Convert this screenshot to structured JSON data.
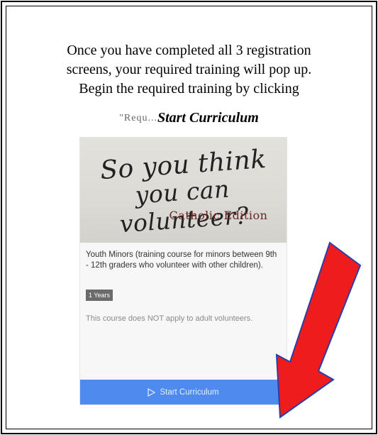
{
  "instructions": {
    "line1": "Once you have completed all 3 registration",
    "line2": "screens, your required training will pop up.",
    "line3": "Begin the required training by clicking",
    "faded_prefix": "\"Requ...",
    "cta_text": "Start Curriculum"
  },
  "course_card": {
    "banner": {
      "line1": "So you think",
      "line2": "you can volunteer?",
      "line3": "Catholic Edition"
    },
    "description": "Youth Minors (training course for minors between 9th - 12th graders who volunteer with other children).",
    "badge": "1 Years",
    "note": "This course does NOT apply to adult volunteers.",
    "start_button_label": "Start Curriculum",
    "start_button_icon": "play-outline-icon",
    "button_color": "#4f8bee"
  },
  "annotation": {
    "arrow_color": "#ee1c1c",
    "arrow_outline": "#2a3ea8"
  }
}
